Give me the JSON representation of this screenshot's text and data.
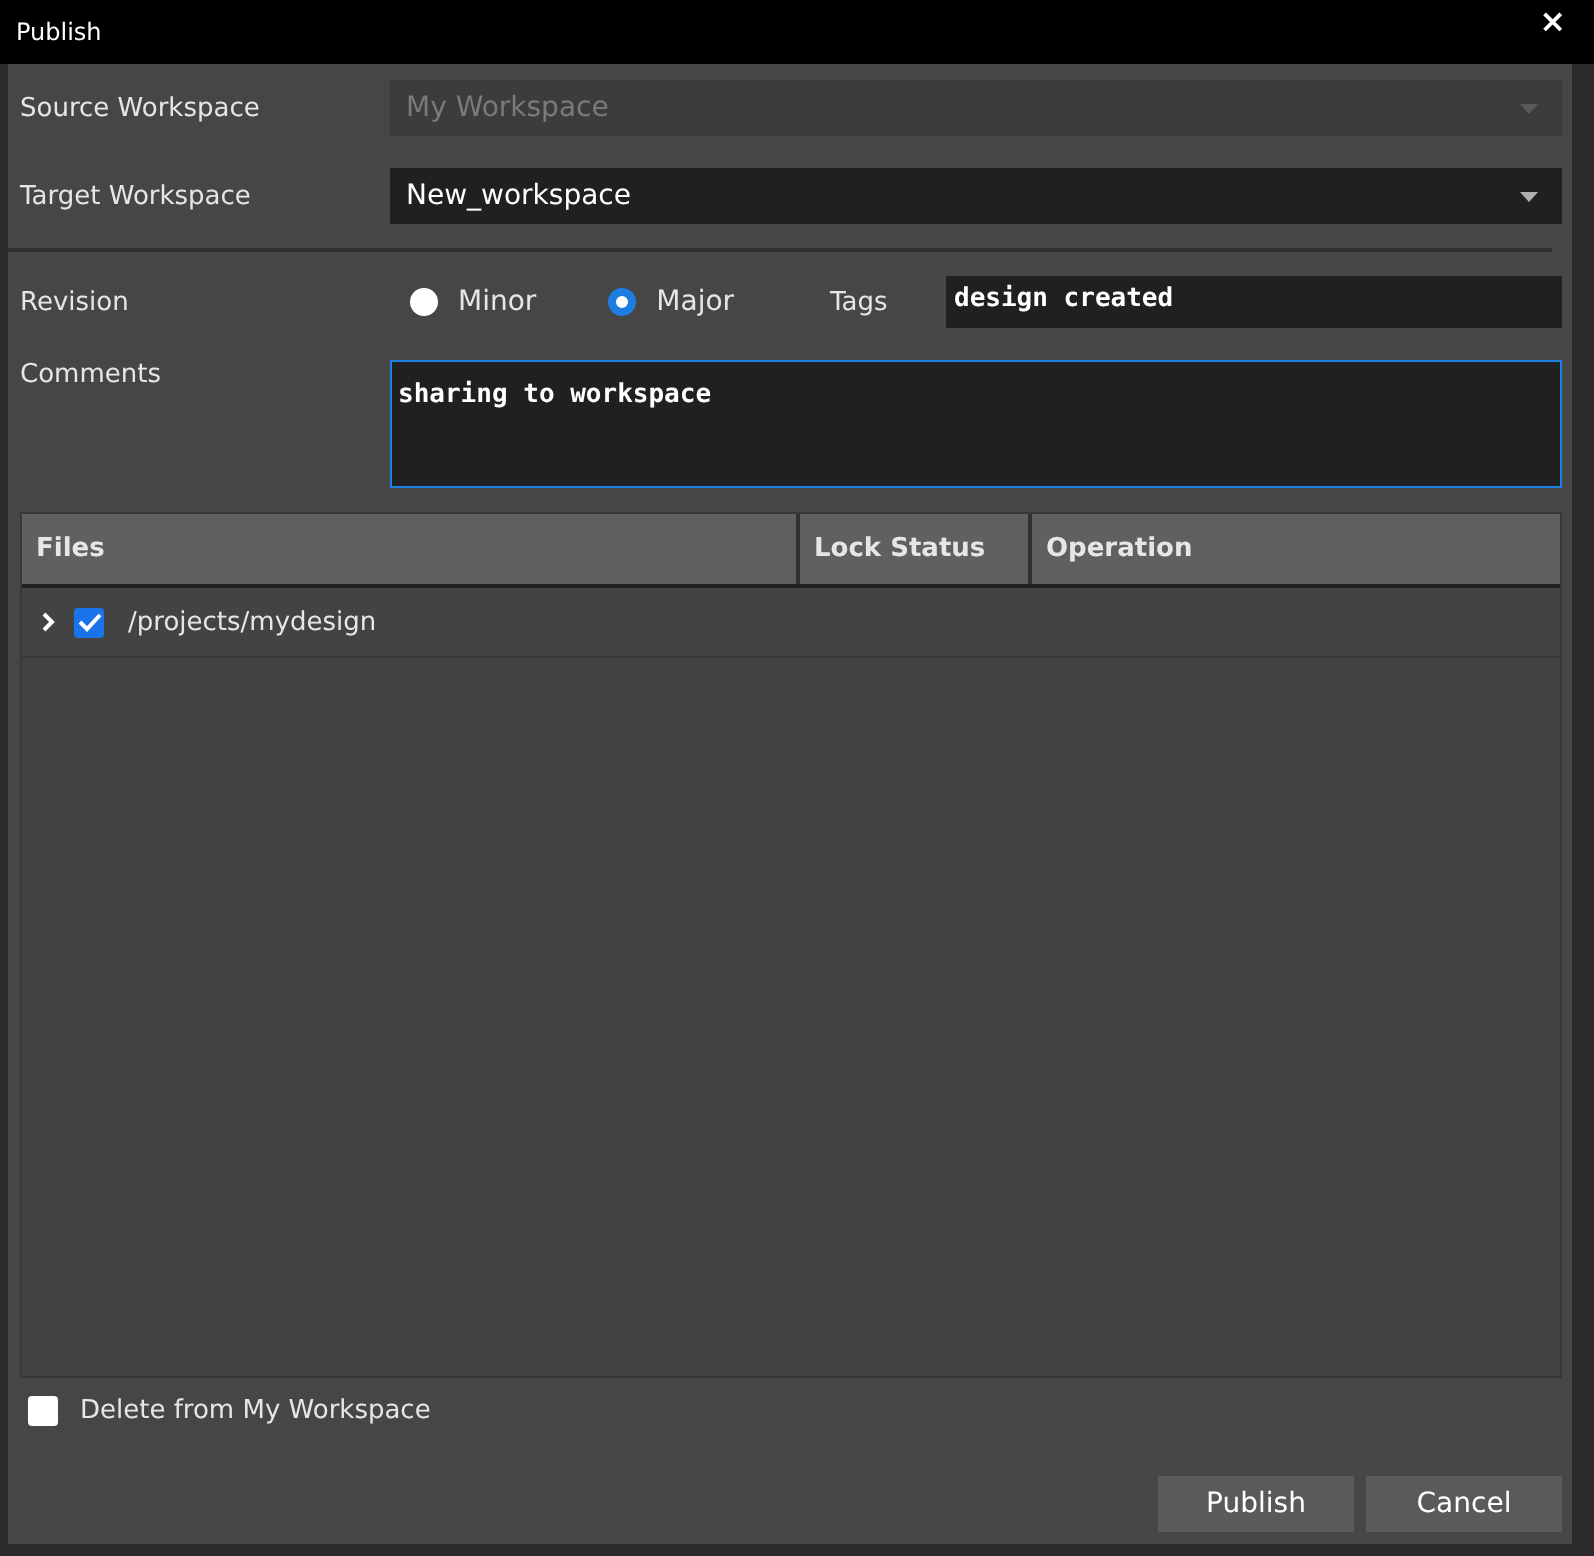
{
  "window": {
    "title": "Publish",
    "close": "×"
  },
  "source_workspace": {
    "label": "Source Workspace",
    "value": "My Workspace",
    "disabled": true
  },
  "target_workspace": {
    "label": "Target Workspace",
    "value": "New_workspace",
    "disabled": false
  },
  "revision": {
    "label": "Revision",
    "options": [
      {
        "label": "Minor",
        "selected": false
      },
      {
        "label": "Major",
        "selected": true
      }
    ]
  },
  "tags": {
    "label": "Tags",
    "value": "design created"
  },
  "comments": {
    "label": "Comments",
    "value": "sharing to workspace"
  },
  "table": {
    "columns": [
      "Files",
      "Lock Status",
      "Operation"
    ],
    "rows": [
      {
        "path": "/projects/mydesign",
        "checked": true,
        "expanded": false
      }
    ]
  },
  "delete_option": {
    "label": "Delete from My Workspace",
    "checked": false
  },
  "buttons": [
    "Publish",
    "Cancel"
  ]
}
